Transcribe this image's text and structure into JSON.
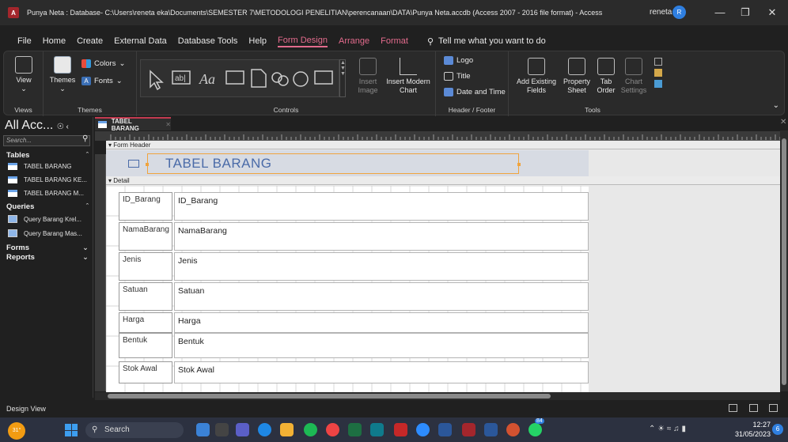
{
  "window": {
    "title": "Punya Neta : Database- C:\\Users\\reneta eka\\Documents\\SEMESTER 7\\METODOLOGI PENELITIAN\\perencanaan\\DATA\\Punya Neta.accdb (Access 2007 - 2016 file format)  -  Access",
    "user_name": "reneta",
    "user_initial": "R"
  },
  "menu": {
    "tabs": [
      "File",
      "Home",
      "Create",
      "External Data",
      "Database Tools",
      "Help",
      "Form Design",
      "Arrange",
      "Format"
    ],
    "active": "Form Design",
    "tellme": "Tell me what you want to do"
  },
  "ribbon": {
    "views": {
      "view_label": "View",
      "group": "Views"
    },
    "themes": {
      "themes_label": "Themes",
      "colors_label": "Colors",
      "fonts_label": "Fonts",
      "group": "Themes"
    },
    "controls": {
      "insert_image_label": "Insert Image",
      "insert_chart_label": "Insert Modern Chart",
      "group": "Controls"
    },
    "header_footer": {
      "logo_label": "Logo",
      "title_label": "Title",
      "date_time_label": "Date and Time",
      "group": "Header / Footer"
    },
    "tools": {
      "add_fields_label": "Add Existing Fields",
      "property_sheet_label": "Property Sheet",
      "tab_order_label": "Tab Order",
      "chart_settings_label": "Chart Settings",
      "group": "Tools"
    }
  },
  "nav": {
    "title": "All Acc...",
    "search_placeholder": "Search...",
    "sections": [
      {
        "name": "Tables",
        "items": [
          "TABEL BARANG",
          "TABEL BARANG KE...",
          "TABEL BARANG M..."
        ]
      },
      {
        "name": "Queries",
        "items": [
          "Query Barang Krel...",
          "Query Barang Mas..."
        ]
      },
      {
        "name": "Forms",
        "items": []
      },
      {
        "name": "Reports",
        "items": []
      }
    ]
  },
  "document": {
    "tab_label": "TABEL BARANG",
    "form_header_band": "Form Header",
    "detail_band": "Detail",
    "header_title": "TABEL BARANG",
    "fields": [
      {
        "label": "ID_Barang",
        "control": "ID_Barang"
      },
      {
        "label": "NamaBarang",
        "control": "NamaBarang"
      },
      {
        "label": "Jenis",
        "control": "Jenis"
      },
      {
        "label": "Satuan",
        "control": "Satuan"
      },
      {
        "label": "Harga",
        "control": "Harga"
      },
      {
        "label": "Bentuk",
        "control": "Bentuk"
      },
      {
        "label": "Stok Awal",
        "control": "Stok Awal"
      }
    ]
  },
  "status": {
    "mode": "Design View"
  },
  "taskbar": {
    "weather": "31°",
    "search_label": "Search",
    "time": "12:27",
    "date": "31/05/2023",
    "notification_count": "6",
    "badge_count": "84"
  }
}
